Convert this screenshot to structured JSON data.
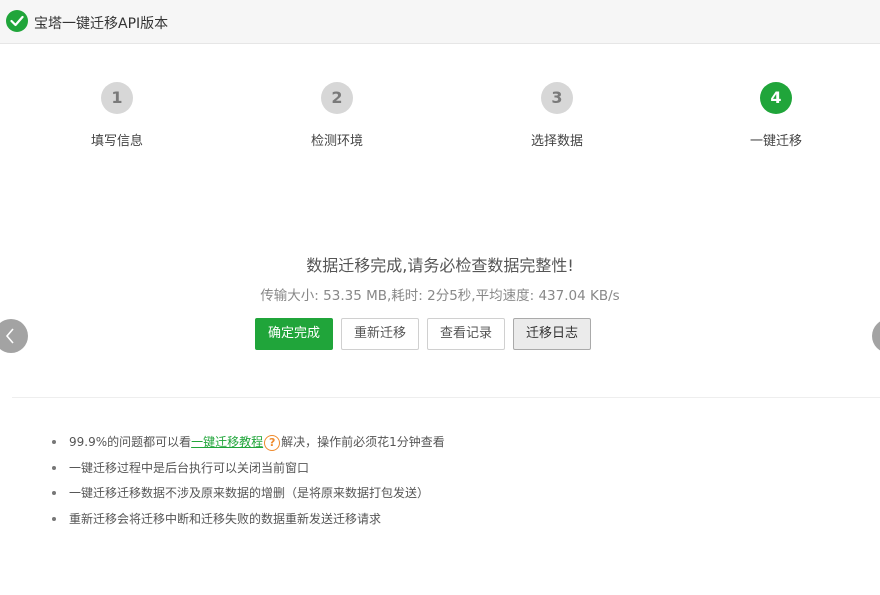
{
  "window": {
    "title": "宝塔一键迁移API版本",
    "status_icon": "check-circle-icon",
    "accent_color": "#20a53a"
  },
  "steps": [
    {
      "number": "1",
      "label": "填写信息",
      "state": "done"
    },
    {
      "number": "2",
      "label": "检测环境",
      "state": "done"
    },
    {
      "number": "3",
      "label": "选择数据",
      "state": "done"
    },
    {
      "number": "4",
      "label": "一键迁移",
      "state": "active"
    }
  ],
  "result": {
    "message": "数据迁移完成,请务必检查数据完整性!",
    "stats": "传输大小: 53.35 MB,耗时: 2分5秒,平均速度: 437.04 KB/s"
  },
  "actions": {
    "confirm": "确定完成",
    "retry": "重新迁移",
    "records": "查看记录",
    "log": "迁移日志"
  },
  "tips": {
    "tip1_prefix": "99.9%的问题都可以看",
    "tip1_link": "一键迁移教程",
    "tip1_help_icon": "?",
    "tip1_suffix": "解决，操作前必须花1分钟查看",
    "tip2": "一键迁移过程中是后台执行可以关闭当前窗口",
    "tip3": "一键迁移迁移数据不涉及原来数据的增删（是将原来数据打包发送）",
    "tip4": "重新迁移会将迁移中断和迁移失败的数据重新发送迁移请求"
  }
}
